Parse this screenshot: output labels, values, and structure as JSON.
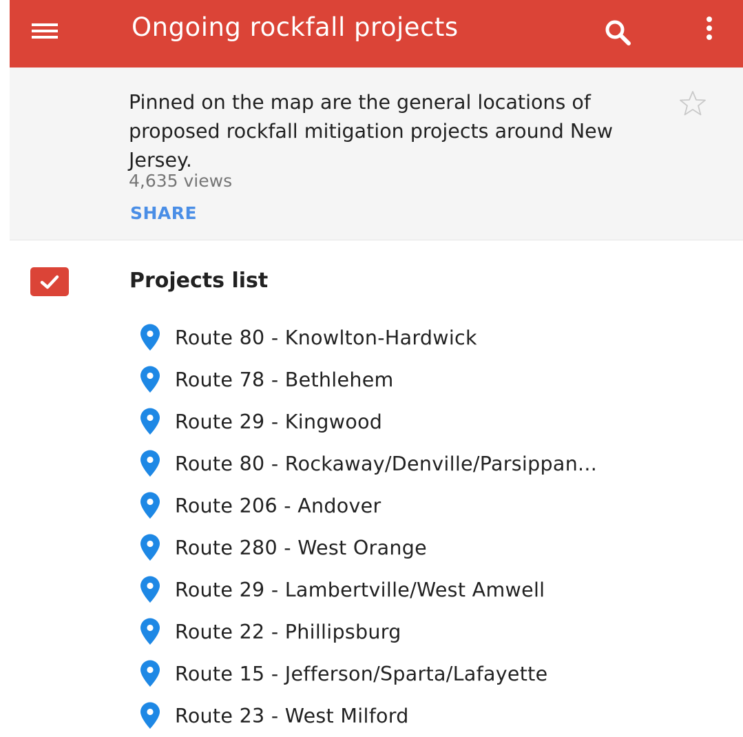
{
  "app_bar": {
    "title": "Ongoing rockfall projects",
    "menu_icon": "hamburger-menu-icon",
    "search_icon": "search-icon",
    "more_icon": "more-vert-icon",
    "background_color": "#db4437"
  },
  "info_card": {
    "description": "Pinned on the map are the general locations of proposed rockfall mitigation projects around New Jersey.",
    "views": "4,635 views",
    "share_label": "SHARE",
    "star_icon": "star-outline-icon",
    "share_color": "#4a8ee6"
  },
  "layer": {
    "checked": true,
    "title": "Projects list",
    "checkbox_color": "#db4437",
    "pin_color": "#1e88e5",
    "items": [
      {
        "label": "Route 80 - Knowlton-Hardwick"
      },
      {
        "label": "Route 78 - Bethlehem"
      },
      {
        "label": "Route 29 - Kingwood"
      },
      {
        "label": "Route 80 - Rockaway/Denville/Parsippan..."
      },
      {
        "label": "Route 206 - Andover"
      },
      {
        "label": "Route 280 - West Orange"
      },
      {
        "label": "Route 29 - Lambertville/West Amwell"
      },
      {
        "label": "Route 22 - Phillipsburg"
      },
      {
        "label": "Route 15 - Jefferson/Sparta/Lafayette"
      },
      {
        "label": "Route 23 - West Milford"
      }
    ]
  }
}
